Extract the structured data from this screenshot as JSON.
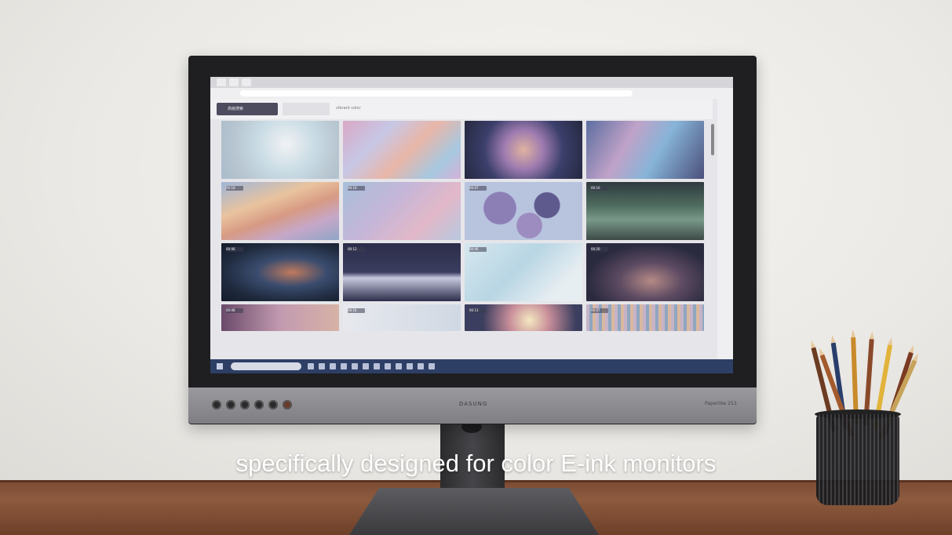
{
  "caption": "specifically designed for color E-ink monitors",
  "monitor": {
    "brand": "DASUNG",
    "model": "Paperlike 253",
    "screen": {
      "toolbar": {
        "filter_label": "高级搜索",
        "search_text": "vibrant color"
      },
      "badges": [
        "00:18",
        "00:16",
        "00:07",
        "00:10",
        "00:06",
        "00:12",
        "00:06",
        "00:20",
        "00:08",
        "00:16",
        "00:13",
        "00:07"
      ]
    }
  },
  "colors": {
    "taskbar": "#2e3f66",
    "filter_button": "#4d4b5e",
    "desk": "#8d5a3e"
  }
}
